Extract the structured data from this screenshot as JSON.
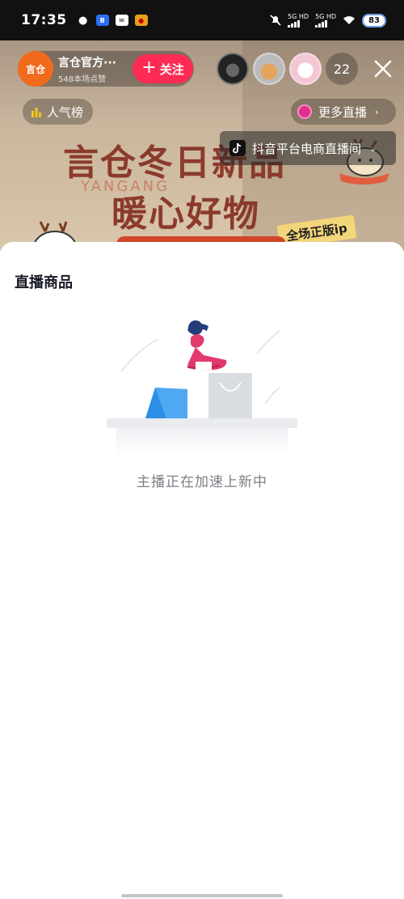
{
  "status_bar": {
    "time": "17:35",
    "apps": [
      "wechat-icon",
      "app-icon-blue",
      "mail-icon",
      "weibo-icon"
    ],
    "network1": "5G HD",
    "network2": "5G HD",
    "battery": "83"
  },
  "live": {
    "host": {
      "avatar_text": "言仓",
      "name": "言仓官方···",
      "likes": "548本场点赞"
    },
    "follow_label": "关注",
    "viewer_count": "22",
    "rank_label": "人气榜",
    "more_live_label": "更多直播",
    "platform_tag": "抖音平台电商直播间",
    "banner": {
      "title_line1": "言仓冬日新品",
      "title_line2": "暖心好物",
      "watermark": "YANGANG",
      "tag": "全场正版ip"
    }
  },
  "sheet": {
    "title": "直播商品",
    "empty_text": "主播正在加速上新中"
  },
  "colors": {
    "brand_red": "#fe2c55",
    "host_orange": "#f26b1d",
    "banner_text": "#8b3a2c"
  }
}
